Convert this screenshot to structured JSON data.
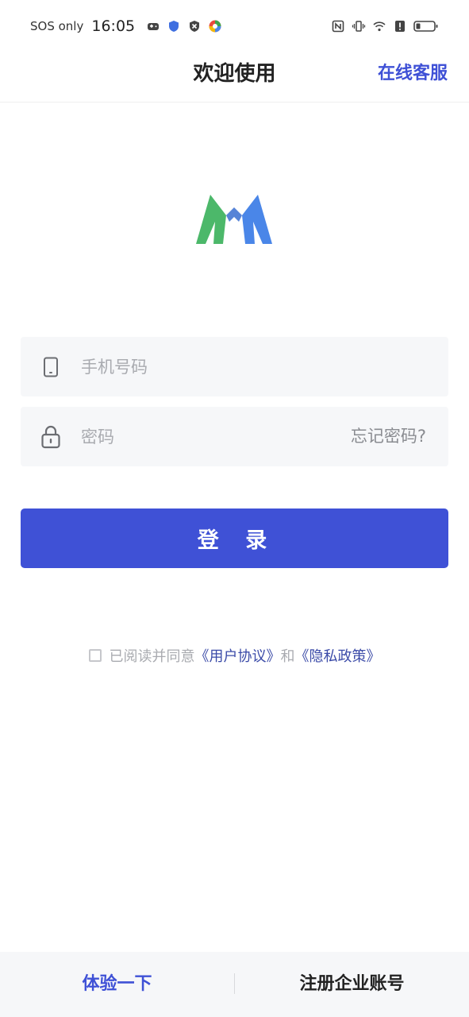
{
  "status_bar": {
    "carrier": "SOS only",
    "time": "16:05"
  },
  "header": {
    "title": "欢迎使用",
    "service_link": "在线客服"
  },
  "form": {
    "phone_placeholder": "手机号码",
    "password_placeholder": "密码",
    "forgot_password": "忘记密码?",
    "login_button": "登 录"
  },
  "agreement": {
    "prefix": "已阅读并同意",
    "user_agreement": "《用户协议》",
    "conjunction": "和",
    "privacy_policy": "《隐私政策》"
  },
  "bottom_bar": {
    "try_label": "体验一下",
    "register_label": "注册企业账号"
  },
  "colors": {
    "primary": "#3f51d6",
    "logo_green": "#4cb86a",
    "logo_blue": "#4a86e8"
  }
}
